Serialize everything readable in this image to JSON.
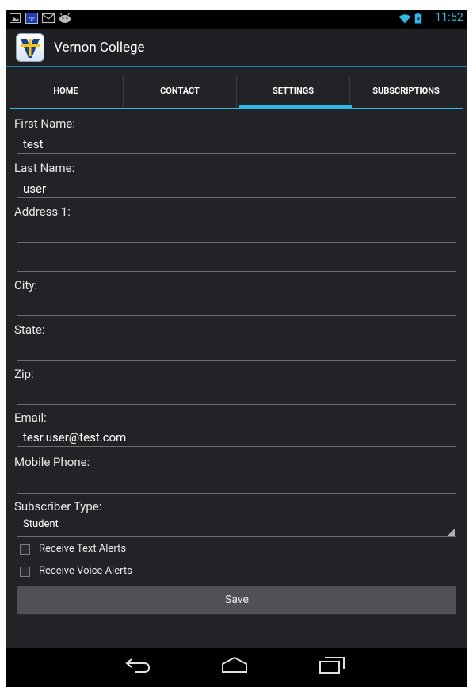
{
  "statusbar": {
    "time": "11:52"
  },
  "app": {
    "title": "Vernon College"
  },
  "tabs": [
    {
      "label": "HOME",
      "selected": false
    },
    {
      "label": "CONTACT",
      "selected": false
    },
    {
      "label": "SETTINGS",
      "selected": true
    },
    {
      "label": "SUBSCRIPTIONS",
      "selected": false
    }
  ],
  "form": {
    "first_name": {
      "label": "First Name:",
      "value": "test"
    },
    "last_name": {
      "label": "Last Name:",
      "value": "user"
    },
    "address1": {
      "label": "Address 1:",
      "value": ""
    },
    "address2": {
      "value": ""
    },
    "city": {
      "label": "City:",
      "value": ""
    },
    "state": {
      "label": "State:",
      "value": ""
    },
    "zip": {
      "label": "Zip:",
      "value": ""
    },
    "email": {
      "label": "Email:",
      "value": "tesr.user@test.com"
    },
    "mobile_phone": {
      "label": "Mobile Phone:",
      "value": ""
    },
    "subscriber_type": {
      "label": "Subscriber Type:",
      "value": "Student"
    },
    "text_alerts": {
      "label": "Receive Text Alerts",
      "checked": false
    },
    "voice_alerts": {
      "label": "Receive Voice Alerts",
      "checked": false
    },
    "save_label": "Save"
  },
  "colors": {
    "accent": "#33b5e5",
    "background": "#222326"
  },
  "icons": {
    "status_left": [
      "gallery-icon",
      "weather-icon",
      "gmail-icon",
      "android-debug-icon"
    ],
    "status_right": [
      "wifi-icon",
      "battery-icon"
    ],
    "nav": [
      "back-icon",
      "home-icon",
      "recent-apps-icon"
    ]
  }
}
